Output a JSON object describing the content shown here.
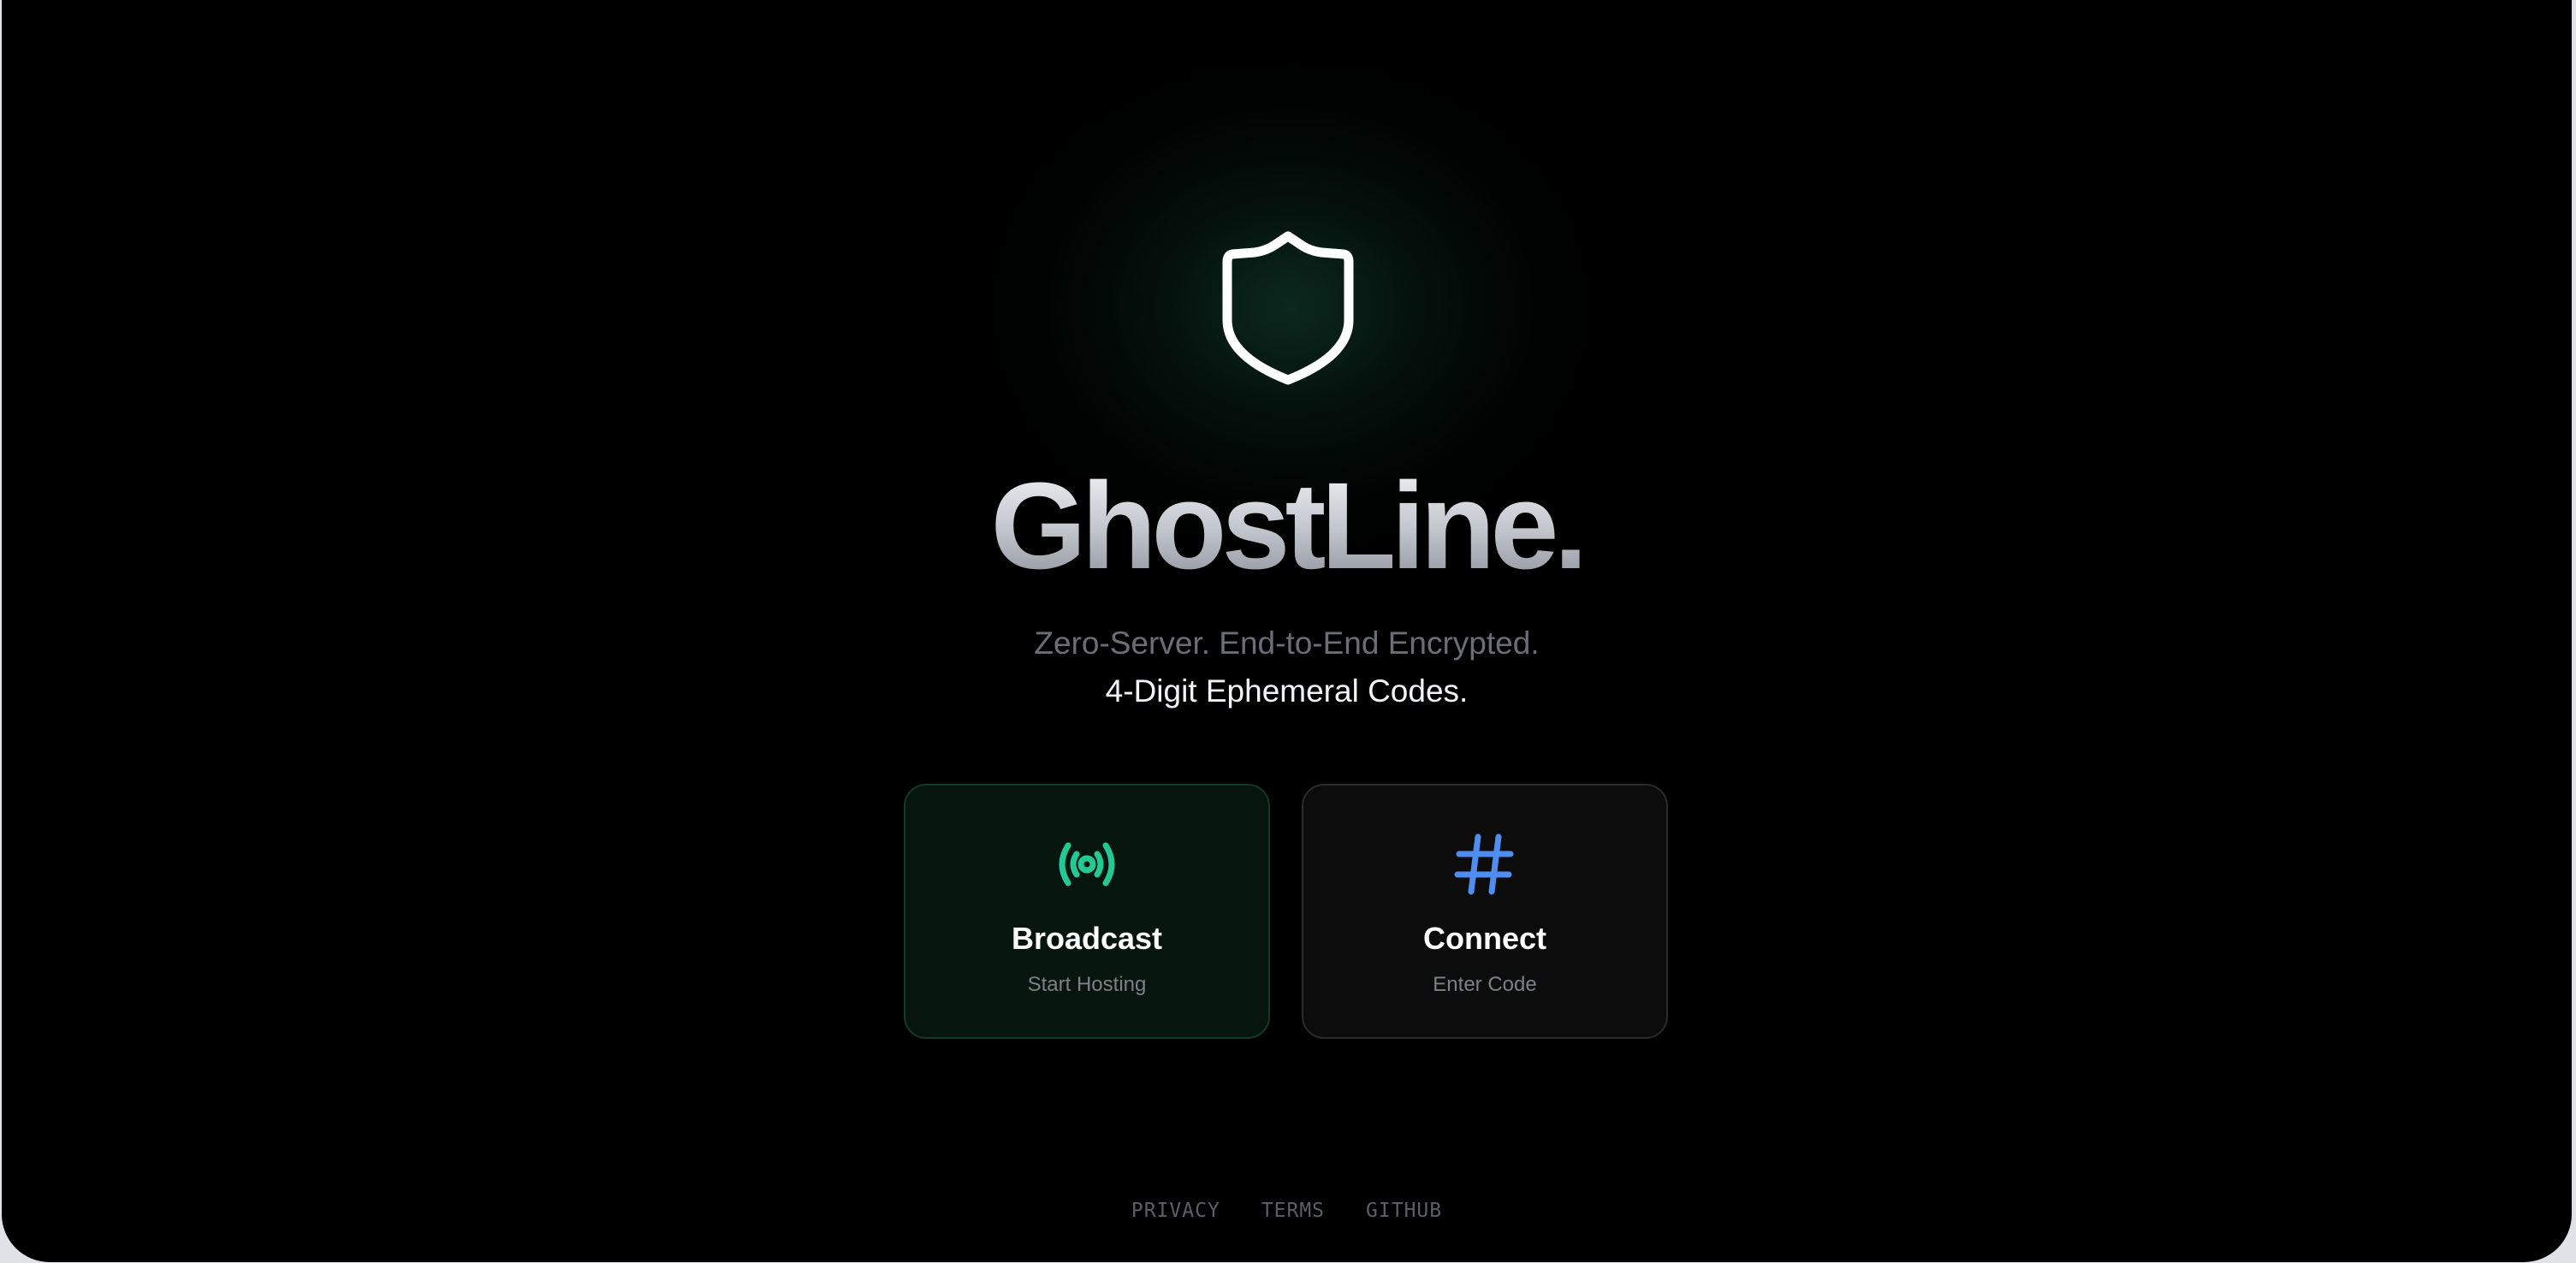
{
  "app": {
    "title": "GhostLine.",
    "tagline_line1": "Zero-Server. End-to-End Encrypted.",
    "tagline_line2": "4-Digit Ephemeral Codes.",
    "hero_icon": "shield-icon"
  },
  "actions": [
    {
      "label": "Broadcast",
      "sublabel": "Start Hosting",
      "icon": "broadcast-icon",
      "accent": "#22c994"
    },
    {
      "label": "Connect",
      "sublabel": "Enter Code",
      "icon": "hash-icon",
      "accent": "#4f8ef0"
    }
  ],
  "footer": {
    "links": [
      "PRIVACY",
      "TERMS",
      "GITHUB"
    ]
  },
  "colors": {
    "background": "#000000",
    "broadcast_card_bg": "#06160f",
    "connect_card_bg": "#0c0c0c",
    "muted_text": "#6b6e74"
  }
}
